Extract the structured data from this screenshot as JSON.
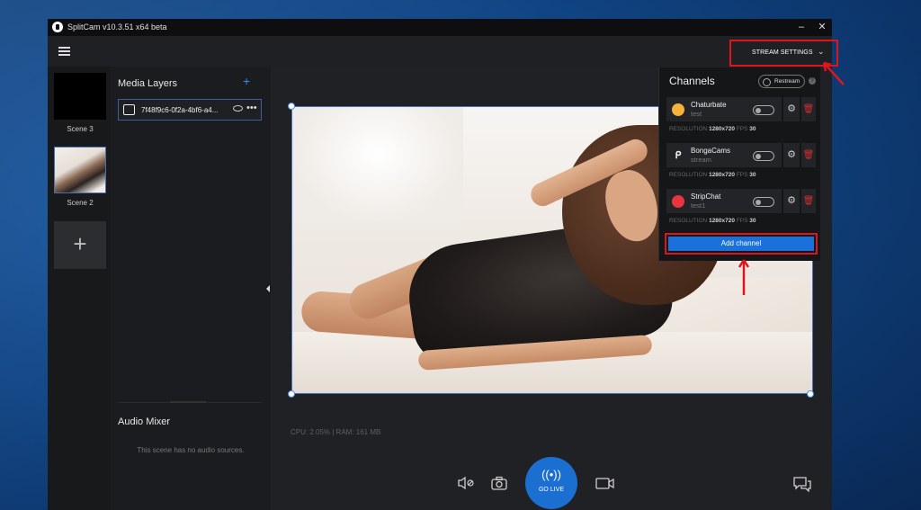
{
  "window": {
    "title": "SplitCam v10.3.51 x64 beta",
    "minimize": "–",
    "close": "✕"
  },
  "toolbar": {
    "stream_settings_label": "STREAM SETTINGS",
    "chevron": "⌄"
  },
  "scenes": [
    {
      "label": "Scene 3",
      "has_image": false
    },
    {
      "label": "Scene 2",
      "has_image": true
    }
  ],
  "add_scene_label": "+",
  "media_layers": {
    "title": "Media Layers",
    "add_label": "+",
    "items": [
      {
        "name": "7f48f9c6-0f2a-4bf6-a4...",
        "more": "•••"
      }
    ]
  },
  "audio_mixer": {
    "title": "Audio Mixer",
    "empty_text": "This scene has no audio sources."
  },
  "stats": "CPU: 2.05% | RAM: 161 MB",
  "controls": {
    "go_live_label": "GO LIVE",
    "go_live_icon": "((•))",
    "mute_icon": "speaker-mute-icon",
    "snapshot_icon": "camera-icon",
    "record_icon": "video-camera-icon",
    "chat_icon": "chat-bubbles-icon"
  },
  "channels_panel": {
    "title": "Channels",
    "restream_label": "Restream",
    "help_label": "?",
    "add_channel_label": "Add channel",
    "resolution_label": "RESOLUTION",
    "fps_label": "FPS",
    "channels": [
      {
        "name": "Chaturbate",
        "sub": "test",
        "resolution": "1280x720",
        "fps": "30",
        "logo_color": "#f4b23a"
      },
      {
        "name": "BongaCams",
        "sub": "stream",
        "resolution": "1280x720",
        "fps": "30",
        "logo_color": "#232427"
      },
      {
        "name": "StripChat",
        "sub": "test1",
        "resolution": "1280x720",
        "fps": "30",
        "logo_color": "#e8343e"
      }
    ]
  },
  "colors": {
    "accent": "#1b6fd1",
    "highlight": "#e0141d",
    "delete": "#d23030"
  }
}
